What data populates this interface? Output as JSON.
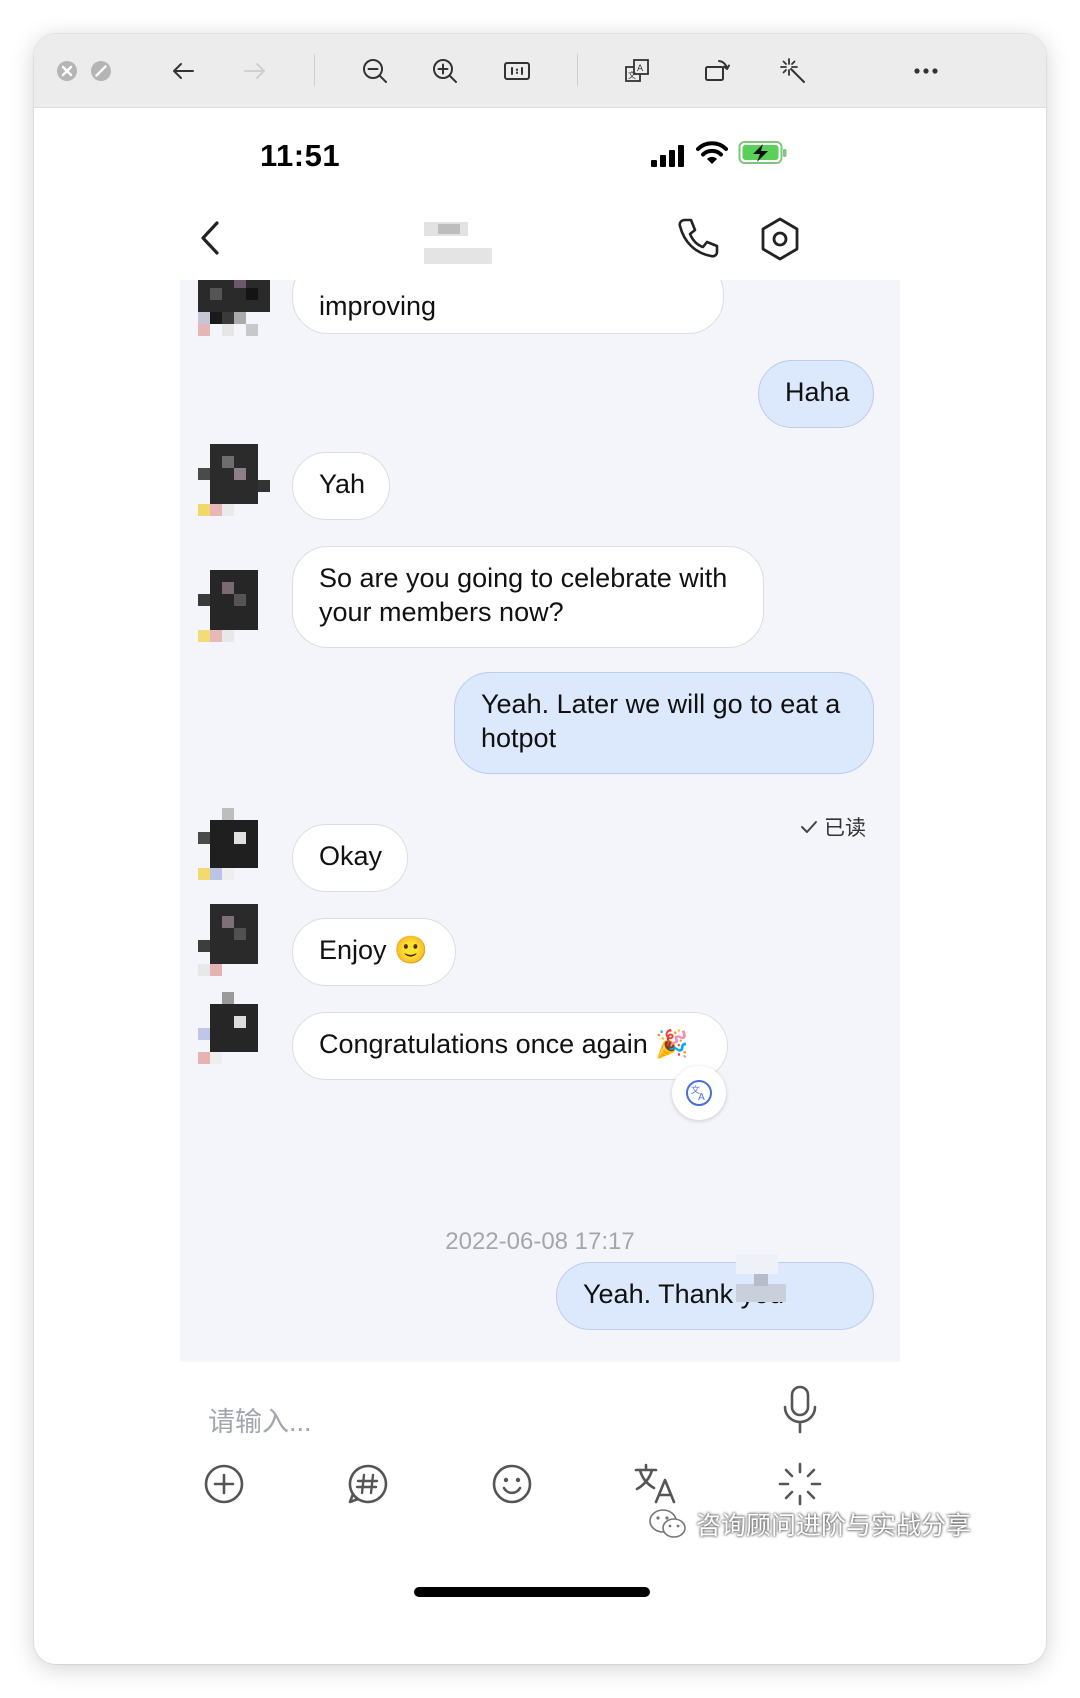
{
  "statusbar": {
    "time": "11:51"
  },
  "navbar": {
    "back_icon": "chevron-left-icon",
    "call_icon": "phone-icon",
    "settings_icon": "hexagon-settings-icon"
  },
  "messages": [
    {
      "dir": "in",
      "text": "improving"
    },
    {
      "dir": "out",
      "text": "Haha"
    },
    {
      "dir": "in",
      "text": "Yah"
    },
    {
      "dir": "in",
      "text": "So are you going to celebrate with your members now?"
    },
    {
      "dir": "out",
      "text": "Yeah. Later we will go to eat a hotpot"
    },
    {
      "dir": "in",
      "text": "Okay"
    },
    {
      "dir": "in",
      "text": "Enjoy 🙂"
    },
    {
      "dir": "in",
      "text": "Congratulations once again 🎉"
    },
    {
      "dir": "out",
      "text": "Yeah. Thank you"
    }
  ],
  "read_receipt": "已读",
  "timestamp": "2022-06-08 17:17",
  "input": {
    "placeholder": "请输入..."
  },
  "watermark": "咨询顾问进阶与实战分享",
  "colors": {
    "outgoing_bubble": "#dce8fb",
    "incoming_bubble": "#ffffff",
    "chat_bg": "#f4f5fa",
    "battery": "#5ad05a"
  }
}
